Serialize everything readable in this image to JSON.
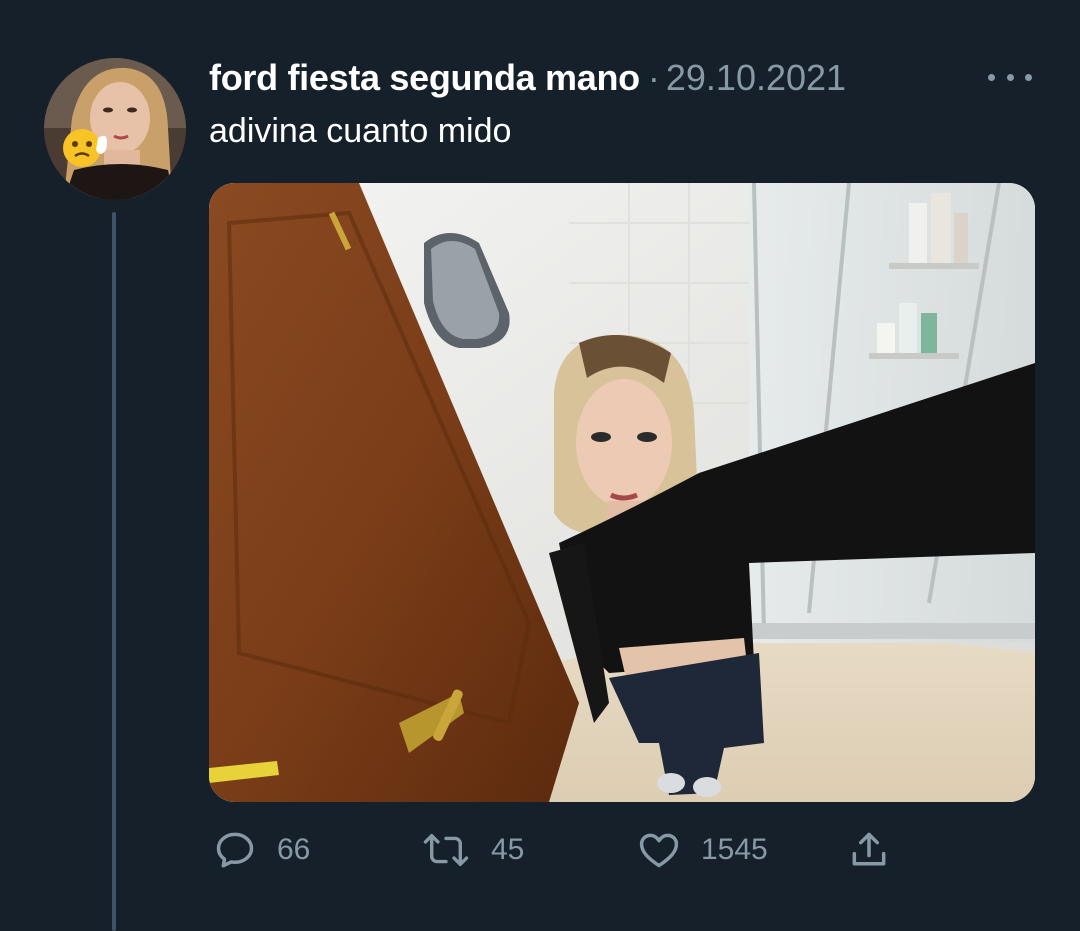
{
  "tweet": {
    "display_name": "ford fiesta segunda mano",
    "separator": "·",
    "date": "29.10.2021",
    "text": "adivina cuanto mido"
  },
  "actions": {
    "reply_count": "66",
    "retweet_count": "45",
    "like_count": "1545"
  },
  "icons": {
    "more": "more-dots-icon",
    "reply": "speech-bubble-icon",
    "retweet": "retweet-arrows-icon",
    "like": "heart-icon",
    "share": "share-upload-icon"
  },
  "colors": {
    "background": "#15202b",
    "secondary_text": "#8899a6",
    "thread_line": "#3d5466"
  }
}
